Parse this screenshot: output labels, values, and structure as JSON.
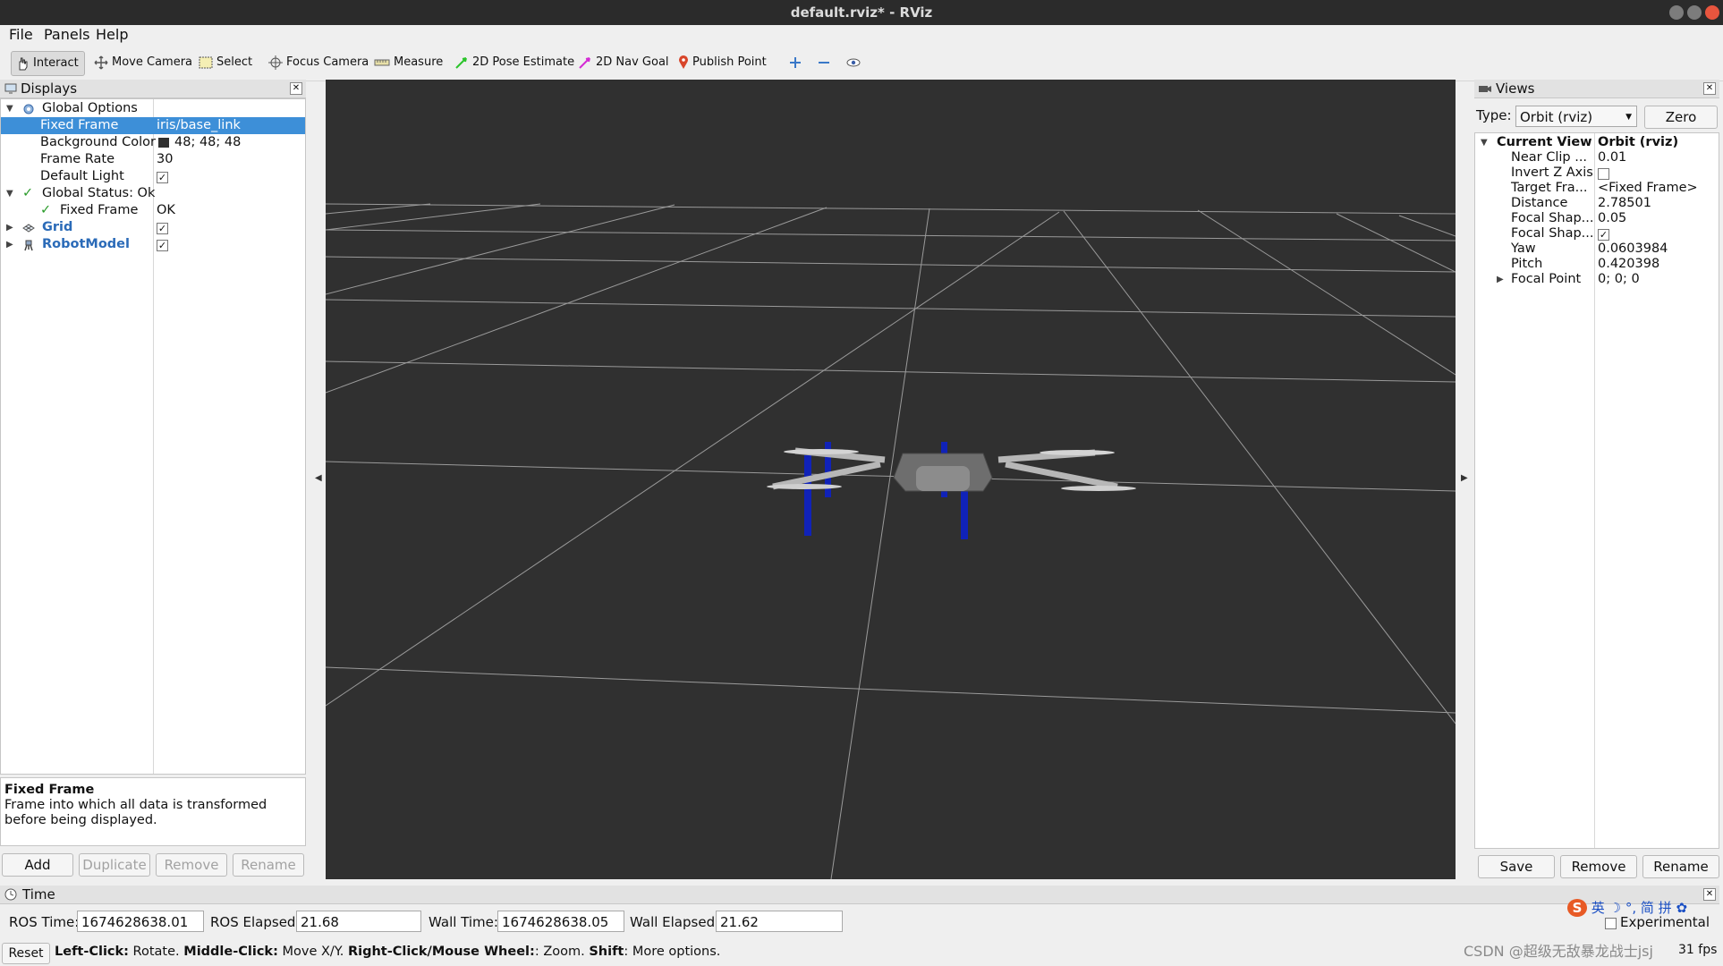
{
  "window": {
    "title": "default.rviz* - RViz"
  },
  "menu": [
    "File",
    "Panels",
    "Help"
  ],
  "toolbar": {
    "tools": [
      {
        "label": "Interact",
        "icon": "hand-icon"
      },
      {
        "label": "Move Camera",
        "icon": "move-camera-icon"
      },
      {
        "label": "Select",
        "icon": "select-icon"
      },
      {
        "label": "Focus Camera",
        "icon": "focus-camera-icon"
      },
      {
        "label": "Measure",
        "icon": "ruler-icon"
      },
      {
        "label": "2D Pose Estimate",
        "icon": "green-arrow-icon"
      },
      {
        "label": "2D Nav Goal",
        "icon": "magenta-arrow-icon"
      },
      {
        "label": "Publish Point",
        "icon": "map-pin-icon"
      }
    ]
  },
  "displays": {
    "title": "Displays",
    "rows": [
      {
        "name": "Global Options",
        "value": ""
      },
      {
        "name": "Fixed Frame",
        "value": "iris/base_link"
      },
      {
        "name": "Background Color",
        "value": "48; 48; 48"
      },
      {
        "name": "Frame Rate",
        "value": "30"
      },
      {
        "name": "Default Light",
        "value": "✓"
      },
      {
        "name": "Global Status: Ok",
        "value": ""
      },
      {
        "name": "Fixed Frame",
        "value": "OK"
      },
      {
        "name": "Grid",
        "value": "✓"
      },
      {
        "name": "RobotModel",
        "value": "✓"
      }
    ],
    "description_title": "Fixed Frame",
    "description_text": "Frame into which all data is transformed before being displayed.",
    "buttons": [
      "Add",
      "Duplicate",
      "Remove",
      "Rename"
    ]
  },
  "views": {
    "title": "Views",
    "type_label": "Type:",
    "type_value": "Orbit (rviz)",
    "zero_label": "Zero",
    "rows": [
      {
        "name": "Current View",
        "value": "Orbit (rviz)"
      },
      {
        "name": "Near Clip ...",
        "value": "0.01"
      },
      {
        "name": "Invert Z Axis",
        "value": ""
      },
      {
        "name": "Target Fra...",
        "value": "<Fixed Frame>"
      },
      {
        "name": "Distance",
        "value": "2.78501"
      },
      {
        "name": "Focal Shap...",
        "value": "0.05"
      },
      {
        "name": "Focal Shap...",
        "value": "✓"
      },
      {
        "name": "Yaw",
        "value": "0.0603984"
      },
      {
        "name": "Pitch",
        "value": "0.420398"
      },
      {
        "name": "Focal Point",
        "value": "0; 0; 0"
      }
    ],
    "buttons": [
      "Save",
      "Remove",
      "Rename"
    ]
  },
  "time": {
    "title": "Time",
    "ros_time_label": "ROS Time:",
    "ros_time": "1674628638.01",
    "ros_elapsed_label": "ROS Elapsed:",
    "ros_elapsed": "21.68",
    "wall_time_label": "Wall Time:",
    "wall_time": "1674628638.05",
    "wall_elapsed_label": "Wall Elapsed:",
    "wall_elapsed": "21.62",
    "experimental_label": "Experimental"
  },
  "statusbar": {
    "reset_label": "Reset",
    "hint_bold1": "Left-Click:",
    "hint1": " Rotate. ",
    "hint_bold2": "Middle-Click:",
    "hint2": " Move X/Y. ",
    "hint_bold3": "Right-Click/Mouse Wheel:",
    "hint3": ": Zoom. ",
    "hint_bold4": "Shift",
    "hint4": ": More options.",
    "fps": "31 fps"
  },
  "ime": {
    "items": [
      "英",
      "简",
      "拼"
    ]
  },
  "watermark": "CSDN @超级无敌暴龙战士jsj",
  "colors": {
    "background": "#303030",
    "grid": "#a0a0a0",
    "selection": "#3d8fd8",
    "legs": "#1022b8"
  }
}
